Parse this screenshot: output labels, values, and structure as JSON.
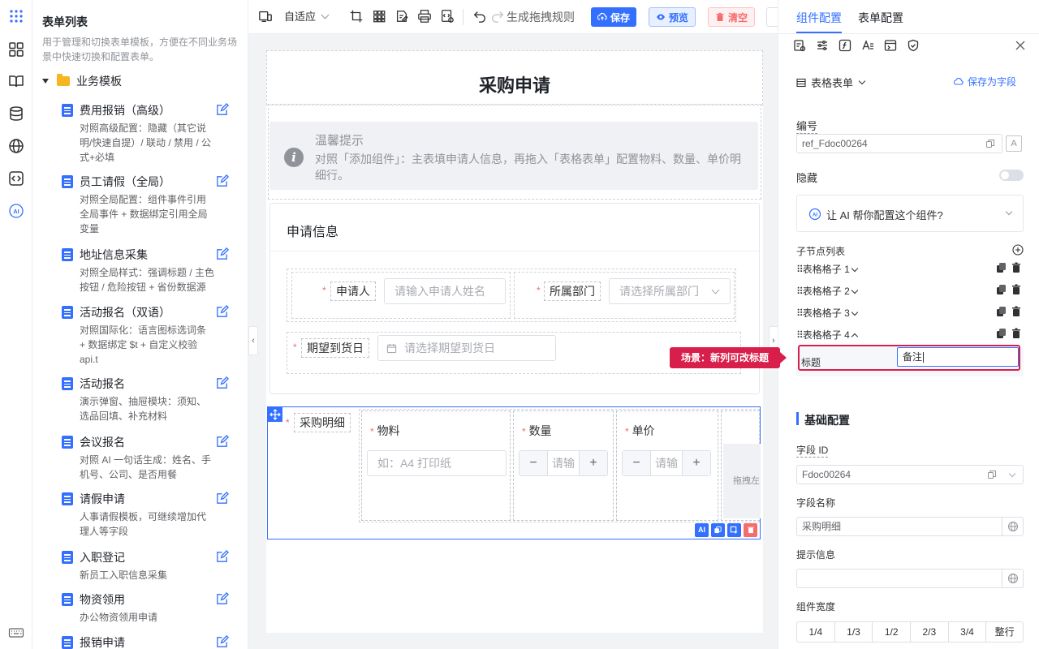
{
  "rail": {
    "icons": [
      "apps-grid-icon",
      "layout-icon",
      "book-icon",
      "database-icon",
      "globe-icon",
      "code-icon",
      "ai-icon",
      "keyboard-icon"
    ],
    "ai_label": "AI"
  },
  "templates": {
    "title": "表单列表",
    "description": "用于管理和切换表单模板，方便在不同业务场景中快速切换和配置表单。",
    "group": "业务模板",
    "items": [
      {
        "name": "费用报销（高级）",
        "desc": "对照高级配置：隐藏（其它说明/快速自提）/ 联动 / 禁用 / 公式+必填"
      },
      {
        "name": "员工请假（全局）",
        "desc": "对照全局配置：组件事件引用全局事件 + 数据绑定引用全局变量"
      },
      {
        "name": "地址信息采集",
        "desc": "对照全局样式：强调标题 / 主色按钮 / 危险按钮 + 省份数据源"
      },
      {
        "name": "活动报名（双语）",
        "desc": "对照国际化：语言图标选词条 + 数据绑定 $t + 自定义校验 api.t"
      },
      {
        "name": "活动报名",
        "desc": "演示弹窗、抽屉模块：须知、选品回填、补充材料"
      },
      {
        "name": "会议报名",
        "desc": "对照 AI 一句话生成：姓名、手机号、公司、是否用餐"
      },
      {
        "name": "请假申请",
        "desc": "人事请假模板，可继续增加代理人等字段"
      },
      {
        "name": "入职登记",
        "desc": "新员工入职信息采集"
      },
      {
        "name": "物资领用",
        "desc": "办公物资领用申请"
      },
      {
        "name": "报销申请",
        "desc": ""
      }
    ]
  },
  "toolbar": {
    "adapt": "自适应",
    "rule": "生成拖拽规则",
    "save": "保存",
    "preview": "预览",
    "clear": "清空"
  },
  "form": {
    "title": "采购申请",
    "tip_title": "温馨提示",
    "tip_text": "对照「添加组件」：主表填申请人信息，再拖入「表格表单」配置物料、数量、单价明细行。",
    "section_title": "申请信息",
    "applicant_label": "申请人",
    "applicant_placeholder": "请输入申请人姓名",
    "dept_label": "所属部门",
    "dept_placeholder": "请选择所属部门",
    "date_label": "期望到货日",
    "date_placeholder": "请选择期望到货日",
    "table_label": "采购明细",
    "col1": "物料",
    "col1_placeholder": "如：A4 打印纸",
    "col2": "数量",
    "col3": "单价",
    "step_placeholder": "请输",
    "drag_hint": "拖拽左",
    "ai_badge": "AI"
  },
  "panel": {
    "tab_component": "组件配置",
    "tab_form": "表单配置",
    "component_type": "表格表单",
    "save_field": "保存为字段",
    "id_label": "编号",
    "id_value": "ref_Fdoc00264",
    "hidden_label": "隐藏",
    "hidden_on": false,
    "ai_prompt": "让 AI 帮你配置这个组件?",
    "children_label": "子节点列表",
    "children": [
      "表格格子 1",
      "表格格子 2",
      "表格格子 3",
      "表格格子 4"
    ],
    "child_title_label": "标题",
    "child_title_value": "备注",
    "basic_title": "基础配置",
    "field_id_label": "字段 ID",
    "field_id_value": "Fdoc00264",
    "field_name_label": "字段名称",
    "field_name_value": "采购明细",
    "hint_label": "提示信息",
    "hint_value": "",
    "width_label": "组件宽度",
    "widths": [
      "1/4",
      "1/3",
      "1/2",
      "2/3",
      "3/4",
      "整行"
    ]
  },
  "callout": "场景：新列可改标题",
  "colors": {
    "primary": "#3370ff",
    "danger": "#f56c6c",
    "callout": "#d81e4a",
    "folder": "#f5b620"
  }
}
